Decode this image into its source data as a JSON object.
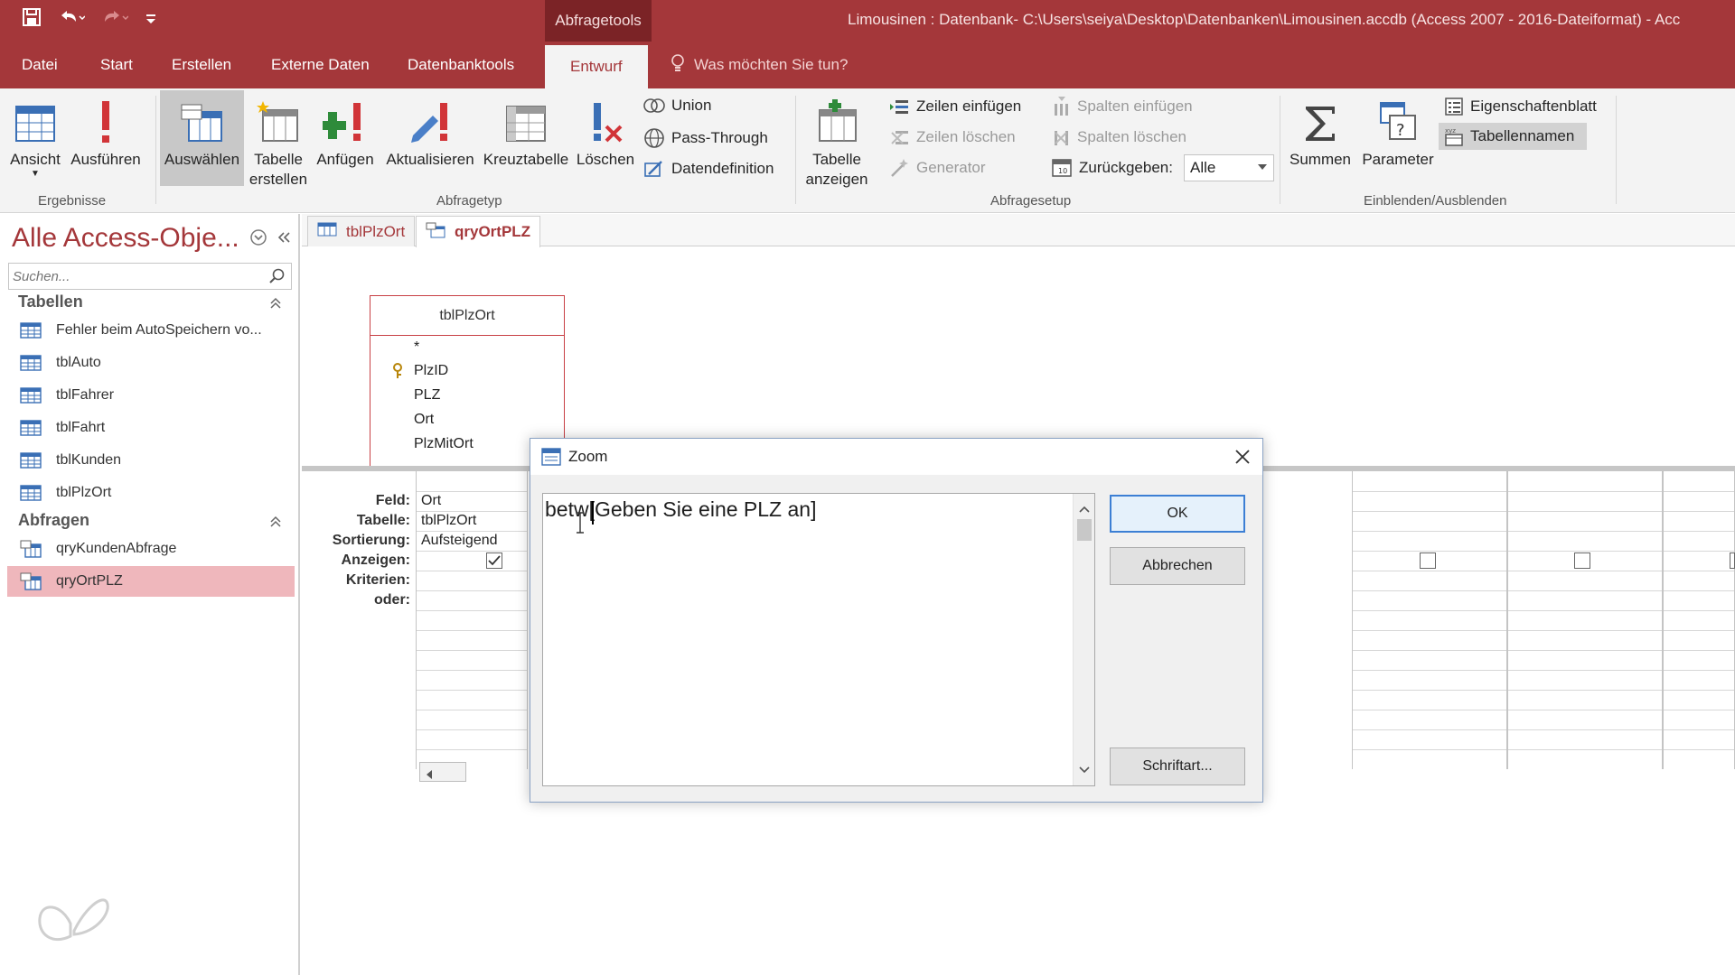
{
  "title_bar": {
    "context_tab": "Abfragetools",
    "document_title": "Limousinen : Datenbank- C:\\Users\\seiya\\Desktop\\Datenbanken\\Limousinen.accdb (Access 2007 - 2016-Dateiformat) - Acc"
  },
  "tabs": [
    {
      "label": "Datei"
    },
    {
      "label": "Start"
    },
    {
      "label": "Erstellen"
    },
    {
      "label": "Externe Daten"
    },
    {
      "label": "Datenbanktools"
    },
    {
      "label": "Entwurf"
    }
  ],
  "tell_me": "Was möchten Sie tun?",
  "ribbon": {
    "ergebnisse": {
      "label": "Ergebnisse",
      "ansicht": "Ansicht",
      "ausfuehren": "Ausführen"
    },
    "abfragetyp": {
      "label": "Abfragetyp",
      "auswaehlen": "Auswählen",
      "tabelle_erstellen_1": "Tabelle",
      "tabelle_erstellen_2": "erstellen",
      "anfuegen": "Anfügen",
      "aktualisieren": "Aktualisieren",
      "kreuztabelle": "Kreuztabelle",
      "loeschen": "Löschen",
      "union": "Union",
      "pass_through": "Pass-Through",
      "datendefinition": "Datendefinition"
    },
    "abfragesetup": {
      "label": "Abfragesetup",
      "tabelle_anzeigen_1": "Tabelle",
      "tabelle_anzeigen_2": "anzeigen",
      "zeilen_einfuegen": "Zeilen einfügen",
      "zeilen_loeschen": "Zeilen löschen",
      "generator": "Generator",
      "spalten_einfuegen": "Spalten einfügen",
      "spalten_loeschen": "Spalten löschen",
      "zurueckgeben": "Zurückgeben:",
      "zurueckgeben_value": "Alle"
    },
    "einblenden": {
      "label": "Einblenden/Ausblenden",
      "summen": "Summen",
      "parameter": "Parameter",
      "eigenschaftenblatt": "Eigenschaftenblatt",
      "tabellennamen": "Tabellennamen"
    }
  },
  "nav": {
    "title": "Alle Access-Obje...",
    "search_placeholder": "Suchen...",
    "sections": [
      {
        "label": "Tabellen",
        "items": [
          "Fehler beim AutoSpeichern vo...",
          "tblAuto",
          "tblFahrer",
          "tblFahrt",
          "tblKunden",
          "tblPlzOrt"
        ]
      },
      {
        "label": "Abfragen",
        "items": [
          "qryKundenAbfrage",
          "qryOrtPLZ"
        ]
      }
    ]
  },
  "doc_tabs": [
    {
      "label": "tblPlzOrt"
    },
    {
      "label": "qryOrtPLZ"
    }
  ],
  "table_box": {
    "name": "tblPlzOrt",
    "fields": [
      "*",
      "PlzID",
      "PLZ",
      "Ort",
      "PlzMitOrt"
    ]
  },
  "grid": {
    "row_labels": [
      "Feld:",
      "Tabelle:",
      "Sortierung:",
      "Anzeigen:",
      "Kriterien:",
      "oder:"
    ],
    "column1": {
      "feld": "Ort",
      "tabelle": "tblPlzOrt",
      "sortierung": "Aufsteigend"
    }
  },
  "zoom_dialog": {
    "title": "Zoom",
    "text": "betw[Geben Sie eine PLZ an]",
    "ok": "OK",
    "cancel": "Abbrechen",
    "font": "Schriftart..."
  },
  "colors": {
    "accent": "#a4373a",
    "selected_nav": "#efb7bc"
  }
}
